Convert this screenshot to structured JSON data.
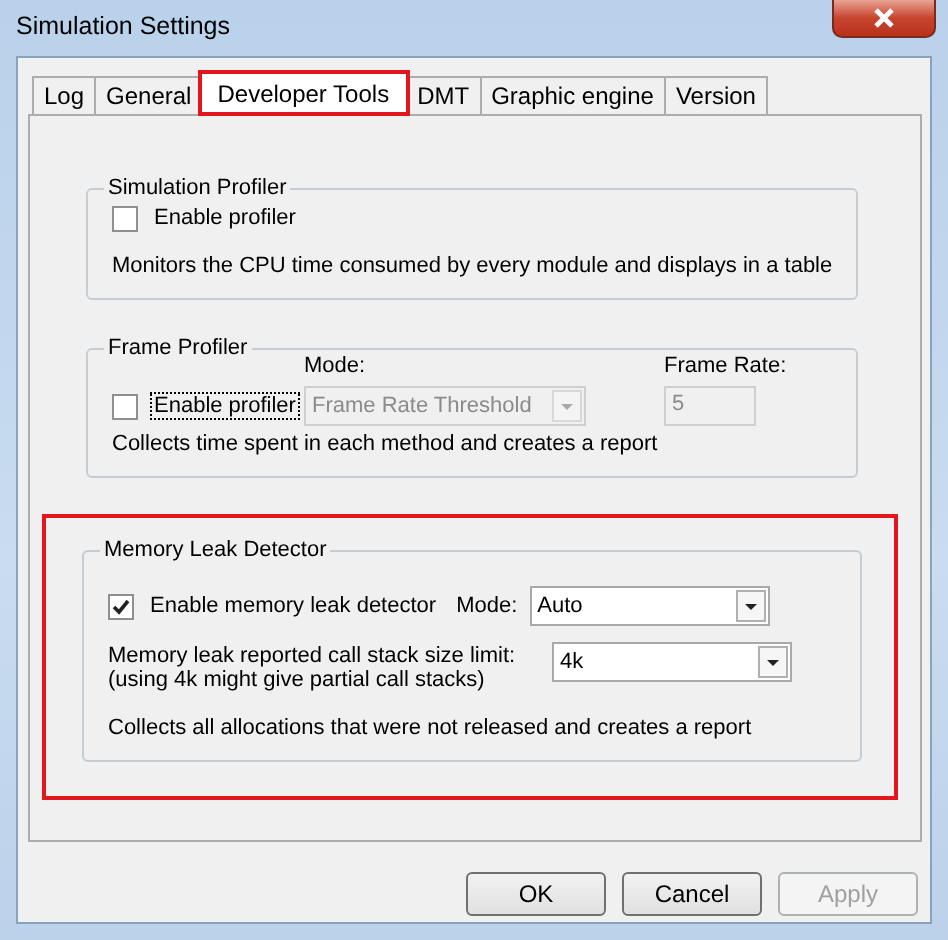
{
  "window": {
    "title": "Simulation Settings"
  },
  "tabs": [
    {
      "label": "Log",
      "selected": false,
      "highlighted": false
    },
    {
      "label": "General",
      "selected": false,
      "highlighted": false
    },
    {
      "label": "Developer Tools",
      "selected": true,
      "highlighted": true
    },
    {
      "label": "DMT",
      "selected": false,
      "highlighted": false
    },
    {
      "label": "Graphic engine",
      "selected": false,
      "highlighted": false
    },
    {
      "label": "Version",
      "selected": false,
      "highlighted": false
    }
  ],
  "groups": [
    {
      "kind": "simple",
      "title": "Simulation Profiler",
      "highlighted": false,
      "checkbox": {
        "label": "Enable profiler",
        "checked": false,
        "focused": false
      },
      "description": "Monitors the CPU time consumed by every module and displays in a table"
    },
    {
      "kind": "frame",
      "title": "Frame Profiler",
      "highlighted": false,
      "mode_label": "Mode:",
      "rate_label": "Frame Rate:",
      "checkbox": {
        "label": "Enable profiler",
        "checked": false,
        "focused": true
      },
      "mode_select": {
        "value": "Frame Rate Threshold",
        "disabled": true
      },
      "rate_field": {
        "value": "5",
        "disabled": true
      },
      "description": "Collects time spent in each method and creates a report"
    },
    {
      "kind": "memory",
      "title": "Memory Leak Detector",
      "highlighted": true,
      "checkbox": {
        "label": "Enable memory leak detector",
        "checked": true,
        "focused": false
      },
      "mode_label": "Mode:",
      "mode_select": {
        "value": "Auto",
        "disabled": false
      },
      "limit_label": "Memory leak reported call stack size limit:",
      "limit_note": "(using 4k might give partial call stacks)",
      "limit_select": {
        "value": "4k",
        "disabled": false
      },
      "description": "Collects all allocations that were not released and creates a report"
    }
  ],
  "buttons": [
    {
      "label": "OK",
      "disabled": false
    },
    {
      "label": "Cancel",
      "disabled": false
    },
    {
      "label": "Apply",
      "disabled": true
    }
  ]
}
